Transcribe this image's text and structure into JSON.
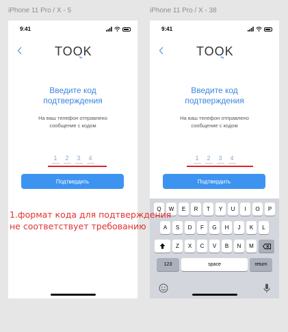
{
  "frames": [
    {
      "title": "iPhone 11 Pro / X - 5",
      "status_time": "9:41",
      "logo_text": "TOOK",
      "heading_line1": "Введите код",
      "heading_line2": "подтверждения",
      "sub_line1": "На ваш телефон отправлено",
      "sub_line2": "сообщение с кодом",
      "code_digits": [
        "1",
        "2",
        "3",
        "4"
      ],
      "confirm_label": "Подтвердить"
    },
    {
      "title": "iPhone 11 Pro / X - 38",
      "status_time": "9:41",
      "logo_text": "TOOK",
      "heading_line1": "Введите код",
      "heading_line2": "подтверждения",
      "sub_line1": "На ваш телефон отправлено",
      "sub_line2": "сообщение с кодом",
      "code_digits": [
        "1",
        "2",
        "3",
        "4"
      ],
      "confirm_label": "Подтвердить"
    }
  ],
  "annotation": {
    "line1": "1.формат кода для подтверждения",
    "line2": "не соответствует требованию"
  },
  "keyboard": {
    "row1": [
      "Q",
      "W",
      "E",
      "R",
      "T",
      "Y",
      "U",
      "I",
      "O",
      "P"
    ],
    "row2": [
      "A",
      "S",
      "D",
      "F",
      "G",
      "H",
      "J",
      "K",
      "L"
    ],
    "row3": [
      "Z",
      "X",
      "C",
      "V",
      "B",
      "N",
      "M"
    ],
    "num_label": "123",
    "space_label": "space",
    "return_label": "return"
  },
  "colors": {
    "accent": "#3d94f0",
    "annotation_red": "#e23030",
    "underline_red": "#d9232d"
  },
  "icons": [
    "back-chevron-icon",
    "signal-icon",
    "wifi-icon",
    "battery-icon",
    "shift-icon",
    "backspace-icon",
    "emoji-icon",
    "microphone-icon"
  ]
}
